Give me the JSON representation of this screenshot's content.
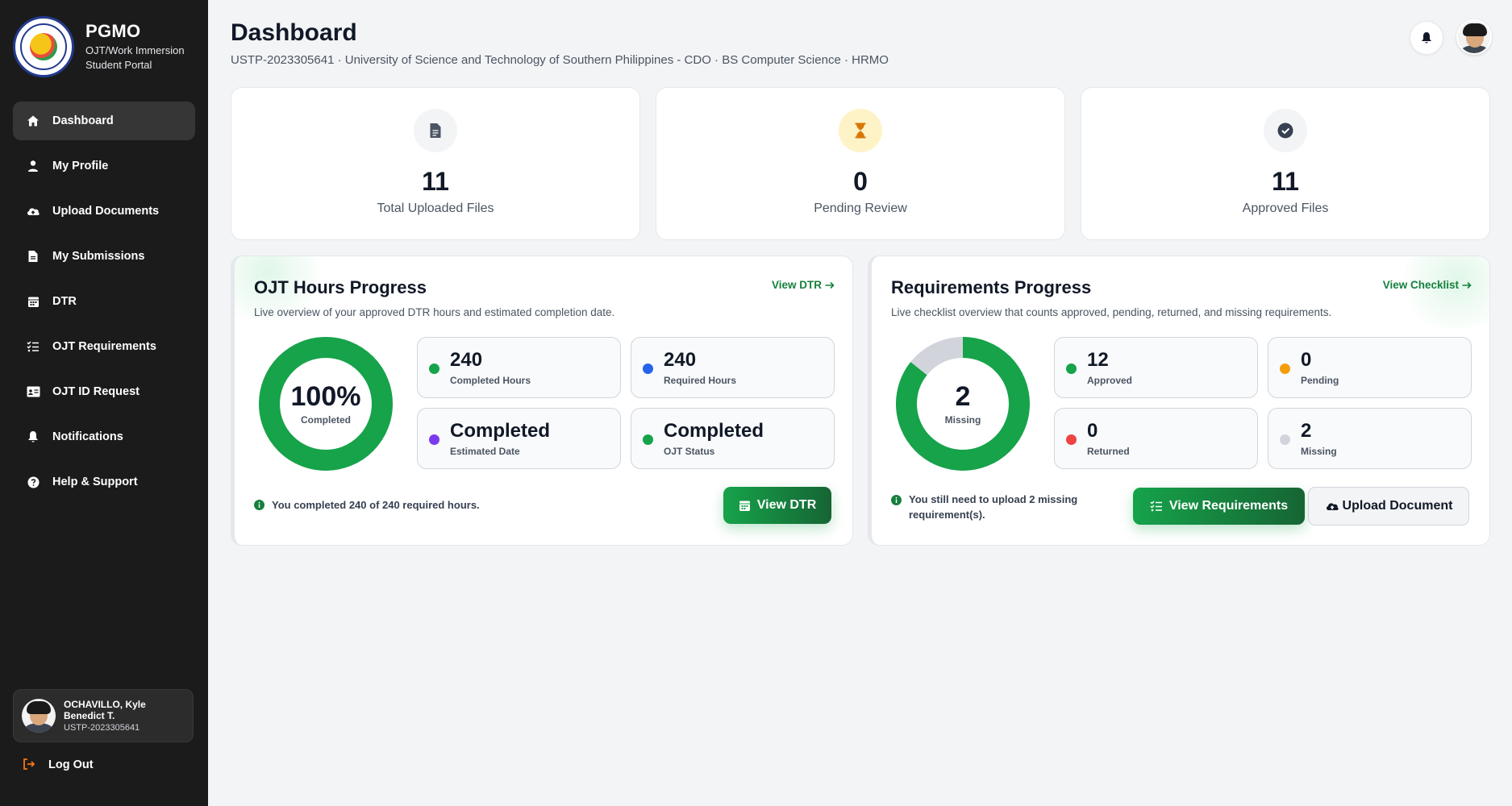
{
  "sidebar": {
    "brand_title": "PGMO",
    "brand_sub1": "OJT/Work Immersion",
    "brand_sub2": "Student Portal",
    "items": [
      {
        "label": "Dashboard",
        "icon": "home-icon"
      },
      {
        "label": "My Profile",
        "icon": "user-icon"
      },
      {
        "label": "Upload Documents",
        "icon": "cloud-upload-icon"
      },
      {
        "label": "My Submissions",
        "icon": "file-icon"
      },
      {
        "label": "DTR",
        "icon": "calendar-icon"
      },
      {
        "label": "OJT Requirements",
        "icon": "checklist-icon"
      },
      {
        "label": "OJT ID Request",
        "icon": "id-card-icon"
      },
      {
        "label": "Notifications",
        "icon": "bell-icon"
      },
      {
        "label": "Help & Support",
        "icon": "question-icon"
      }
    ],
    "user_name": "OCHAVILLO, Kyle Benedict T.",
    "user_id": "USTP-2023305641",
    "logout": "Log Out"
  },
  "header": {
    "title": "Dashboard",
    "subtitle": "USTP-2023305641 · University of Science and Technology of Southern Philippines - CDO · BS Computer Science · HRMO"
  },
  "stats": [
    {
      "value": "11",
      "label": "Total Uploaded Files",
      "icon": "document-icon"
    },
    {
      "value": "0",
      "label": "Pending Review",
      "icon": "hourglass-icon"
    },
    {
      "value": "11",
      "label": "Approved Files",
      "icon": "check-circle-icon"
    }
  ],
  "ojt": {
    "title": "OJT Hours Progress",
    "subtitle": "Live overview of your approved DTR hours and estimated completion date.",
    "link": "View DTR",
    "percent_text": "100%",
    "percent_label": "Completed",
    "progress": 1.0,
    "cards": [
      {
        "value": "240",
        "label": "Completed Hours",
        "dot": "#16a34a"
      },
      {
        "value": "240",
        "label": "Required Hours",
        "dot": "#2563eb"
      },
      {
        "value": "Completed",
        "label": "Estimated Date",
        "dot": "#7c3aed"
      },
      {
        "value": "Completed",
        "label": "OJT Status",
        "dot": "#16a34a"
      }
    ],
    "note": "You completed 240 of 240 required hours.",
    "button": "View DTR"
  },
  "req": {
    "title": "Requirements Progress",
    "subtitle": "Live checklist overview that counts approved, pending, returned, and missing requirements.",
    "link": "View Checklist",
    "center_value": "2",
    "center_label": "Missing",
    "approved": 12,
    "missing": 2,
    "cards": [
      {
        "value": "12",
        "label": "Approved",
        "dot": "#16a34a"
      },
      {
        "value": "0",
        "label": "Pending",
        "dot": "#f59e0b"
      },
      {
        "value": "0",
        "label": "Returned",
        "dot": "#ef4444"
      },
      {
        "value": "2",
        "label": "Missing",
        "dot": "#d1d5db"
      }
    ],
    "note": "You still need to upload 2 missing requirement(s).",
    "button_primary": "View Requirements",
    "button_secondary": "Upload Document"
  },
  "colors": {
    "accent": "#16a34a",
    "sidebar_bg": "#1b1b1b",
    "track": "#d1d5db"
  }
}
